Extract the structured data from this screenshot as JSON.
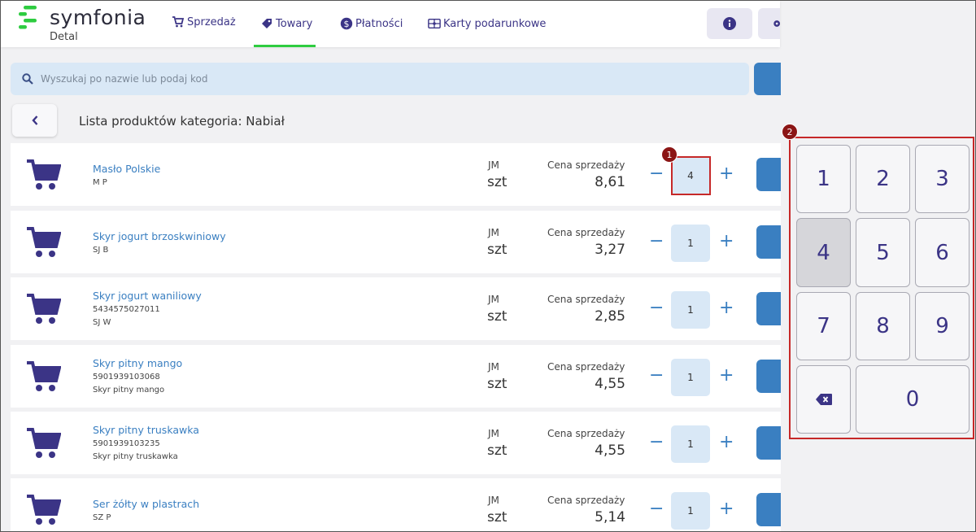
{
  "app": {
    "brand": "symfonia",
    "sub": "Detal"
  },
  "nav": [
    {
      "label": "Sprzedaż",
      "icon": "cart-icon"
    },
    {
      "label": "Towary",
      "icon": "tag-icon",
      "active": true
    },
    {
      "label": "Płatności",
      "icon": "dollar-icon"
    },
    {
      "label": "Karty podarunkowe",
      "icon": "gift-card-icon"
    }
  ],
  "header_buttons": [
    "info-icon",
    "gear-icon"
  ],
  "search": {
    "placeholder": "Wyszukaj po nazwie lub podaj kod"
  },
  "list_title": "Lista produktów kategoria: Nabiał",
  "labels": {
    "jm": "JM",
    "price": "Cena sprzedaży",
    "minus": "−",
    "plus": "+"
  },
  "products": [
    {
      "name": "Masło Polskie",
      "lines": [
        "M P"
      ],
      "jm": "szt",
      "price": "8,61",
      "qty": "4"
    },
    {
      "name": "Skyr jogurt brzoskwiniowy",
      "lines": [
        "SJ B"
      ],
      "jm": "szt",
      "price": "3,27",
      "qty": "1"
    },
    {
      "name": "Skyr jogurt waniliowy",
      "lines": [
        "5434575027011",
        "SJ W"
      ],
      "jm": "szt",
      "price": "2,85",
      "qty": "1"
    },
    {
      "name": "Skyr pitny mango",
      "lines": [
        "5901939103068",
        "Skyr pitny mango"
      ],
      "jm": "szt",
      "price": "4,55",
      "qty": "1"
    },
    {
      "name": "Skyr pitny truskawka",
      "lines": [
        "5901939103235",
        "Skyr pitny truskawka"
      ],
      "jm": "szt",
      "price": "4,55",
      "qty": "1"
    },
    {
      "name": "Ser żółty w plastrach",
      "lines": [
        "SZ P"
      ],
      "jm": "szt",
      "price": "5,14",
      "qty": "1"
    }
  ],
  "keypad": {
    "keys": [
      "1",
      "2",
      "3",
      "4",
      "5",
      "6",
      "7",
      "8",
      "9",
      "0"
    ],
    "active_key": "4",
    "backspace_icon": "backspace-icon"
  },
  "annotations": [
    "1",
    "2"
  ],
  "colors": {
    "accent": "#3a7fc1",
    "nav": "#3b3486",
    "brand_green": "#2ecc40",
    "highlight": "#c62828"
  }
}
